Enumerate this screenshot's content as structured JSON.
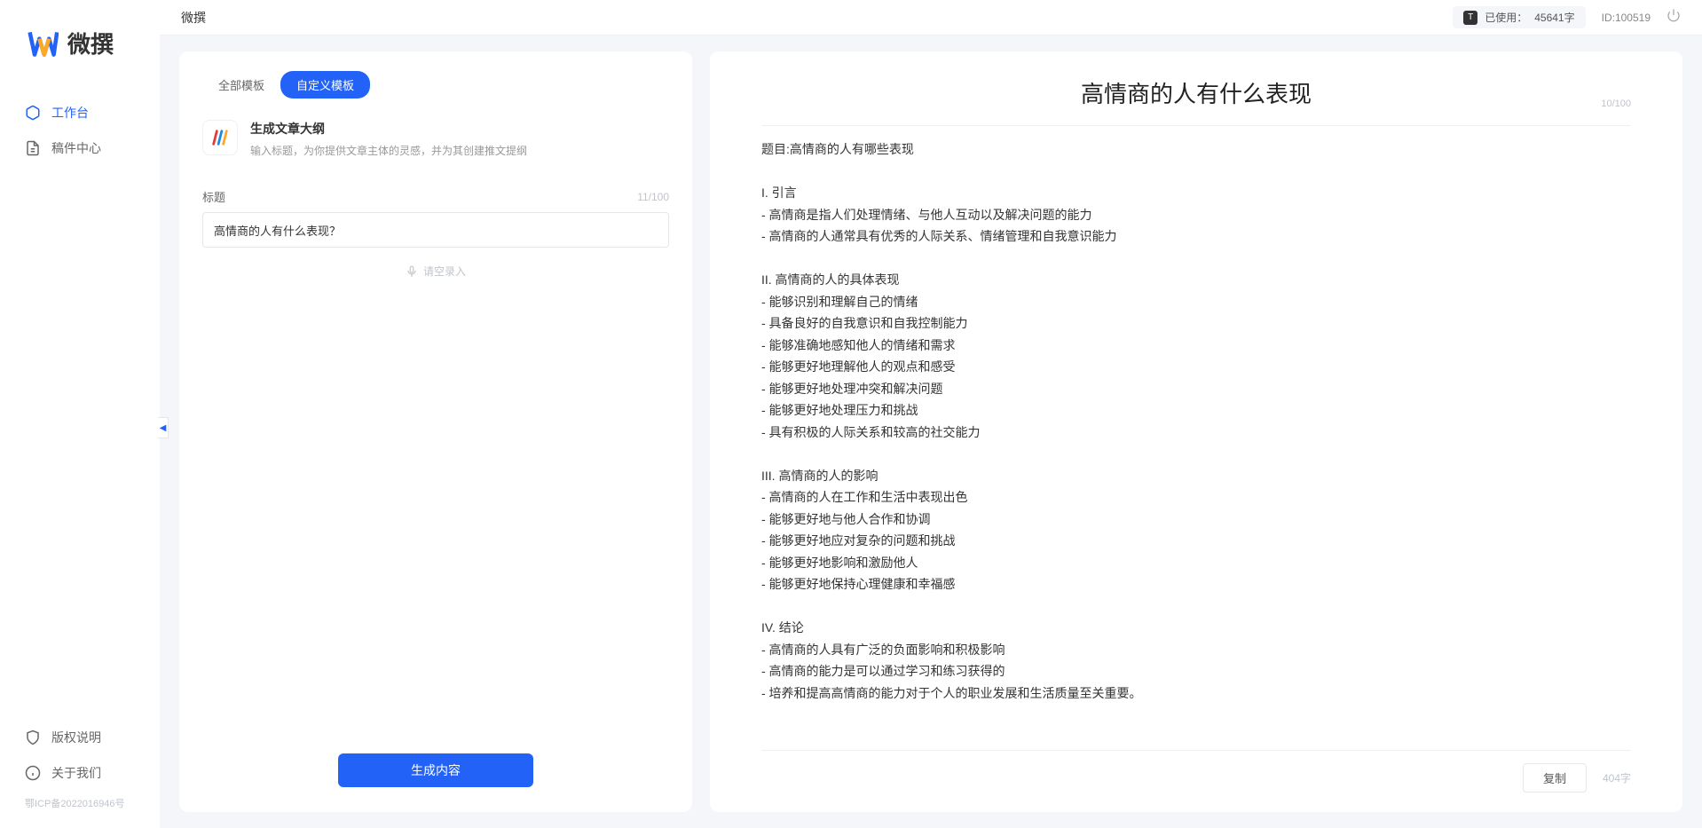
{
  "app": {
    "brand": "微撰",
    "title": "微撰"
  },
  "sidebar": {
    "nav": [
      {
        "label": "工作台",
        "active": true
      },
      {
        "label": "稿件中心",
        "active": false
      }
    ],
    "bottom": [
      {
        "label": "版权说明"
      },
      {
        "label": "关于我们"
      }
    ],
    "icp": "鄂ICP备2022016946号"
  },
  "topbar": {
    "usage_label": "已使用：",
    "usage_value": "45641字",
    "usage_badge": "T",
    "user_id": "ID:100519"
  },
  "leftPanel": {
    "tabs": [
      {
        "label": "全部模板",
        "active": false
      },
      {
        "label": "自定义模板",
        "active": true
      }
    ],
    "template": {
      "title": "生成文章大纲",
      "desc": "输入标题，为你提供文章主体的灵感，并为其创建推文提纲"
    },
    "field": {
      "label": "标题",
      "counter": "11/100",
      "value": "高情商的人有什么表现？"
    },
    "voice_label": "请空录入",
    "generate_label": "生成内容"
  },
  "output": {
    "title": "高情商的人有什么表现",
    "title_counter": "10/100",
    "body": "题目:高情商的人有哪些表现\n\nI. 引言\n- 高情商是指人们处理情绪、与他人互动以及解决问题的能力\n- 高情商的人通常具有优秀的人际关系、情绪管理和自我意识能力\n\nII. 高情商的人的具体表现\n- 能够识别和理解自己的情绪\n- 具备良好的自我意识和自我控制能力\n- 能够准确地感知他人的情绪和需求\n- 能够更好地理解他人的观点和感受\n- 能够更好地处理冲突和解决问题\n- 能够更好地处理压力和挑战\n- 具有积极的人际关系和较高的社交能力\n\nIII. 高情商的人的影响\n- 高情商的人在工作和生活中表现出色\n- 能够更好地与他人合作和协调\n- 能够更好地应对复杂的问题和挑战\n- 能够更好地影响和激励他人\n- 能够更好地保持心理健康和幸福感\n\nIV. 结论\n- 高情商的人具有广泛的负面影响和积极影响\n- 高情商的能力是可以通过学习和练习获得的\n- 培养和提高高情商的能力对于个人的职业发展和生活质量至关重要。",
    "copy_label": "复制",
    "char_count": "404字"
  }
}
